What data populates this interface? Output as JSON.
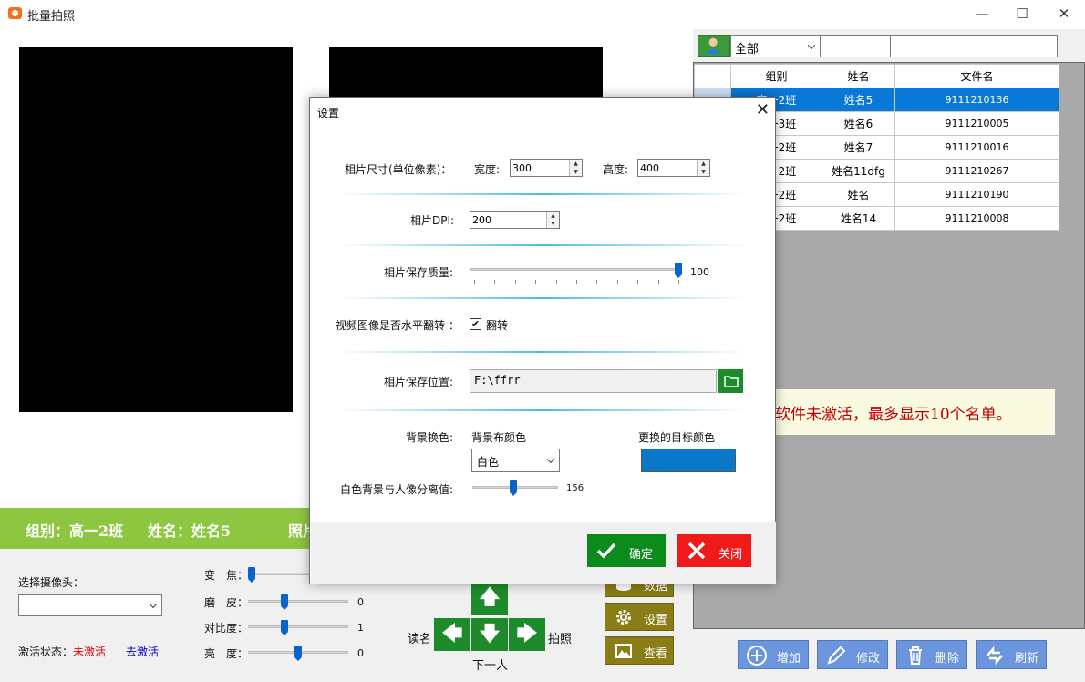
{
  "window": {
    "title": "批量拍照",
    "minimize_icon": "minimize-icon",
    "maximize_icon": "maximize-icon",
    "close_icon": "close-icon"
  },
  "info_bar": {
    "group_text": "组别：高一2班",
    "name_text": "姓名：姓名5",
    "photo_text": "照片"
  },
  "bottom": {
    "camera_label": "选择摄像头：",
    "camera_value": "",
    "activation_label": "激活状态：",
    "activation_status": "未激活",
    "activate_link": "去激活",
    "sliders": [
      {
        "label": "变　焦：",
        "value": "",
        "level": 0.0
      },
      {
        "label": "磨　皮：",
        "value": "0",
        "level": 0.35
      },
      {
        "label": "对比度：",
        "value": "1",
        "level": 0.35
      },
      {
        "label": "亮　度：",
        "value": "0",
        "level": 0.5
      }
    ],
    "read_name_label": "读名",
    "take_photo_label": "拍照",
    "next_person_label": "下一人",
    "side_buttons": [
      {
        "label": "数据",
        "icon": "database-icon"
      },
      {
        "label": "设置",
        "icon": "gear-icon"
      },
      {
        "label": "查看",
        "icon": "image-icon"
      }
    ]
  },
  "right_panel": {
    "filter_value": "全部",
    "filter_input1": "",
    "filter_input2": "",
    "columns": [
      "组别",
      "姓名",
      "文件名"
    ],
    "rows": [
      {
        "group": "高一2班",
        "name": "姓名5",
        "file": "9111210136",
        "selected": true
      },
      {
        "group": "高一3班",
        "name": "姓名6",
        "file": "9111210005",
        "selected": false
      },
      {
        "group": "高一2班",
        "name": "姓名7",
        "file": "9111210016",
        "selected": false
      },
      {
        "group": "高一2班",
        "name": "姓名11dfg",
        "file": "9111210267",
        "selected": false
      },
      {
        "group": "高一2班",
        "name": "姓名",
        "file": "9111210190",
        "selected": false
      },
      {
        "group": "高一2班",
        "name": "姓名14",
        "file": "9111210008",
        "selected": false
      }
    ],
    "notice": "因软件未激活，最多显示10个名单。",
    "actions": [
      {
        "label": "增加",
        "icon": "plus-circle-icon"
      },
      {
        "label": "修改",
        "icon": "pencil-icon"
      },
      {
        "label": "删除",
        "icon": "trash-icon"
      },
      {
        "label": "刷新",
        "icon": "refresh-icon"
      }
    ]
  },
  "dialog": {
    "title": "设置",
    "photo_size_label": "相片尺寸(单位像素)：",
    "width_label": "宽度:",
    "width_value": "300",
    "height_label": "高度:",
    "height_value": "400",
    "dpi_label": "相片DPI:",
    "dpi_value": "200",
    "quality_label": "相片保存质量:",
    "quality_value": "100",
    "quality_level": 1.0,
    "flip_label": "视频图像是否水平翻转 ：",
    "flip_checkbox_label": "翻转",
    "flip_checked": true,
    "save_path_label": "相片保存位置:",
    "save_path_value": "F:\\ffrr",
    "bg_change_label": "背景换色:",
    "bg_cloth_color_label": "背景布颜色",
    "bg_cloth_color_value": "白色",
    "target_color_label": "更换的目标颜色",
    "target_color": "#0a78c8",
    "separation_label": "白色背景与人像分离值:",
    "separation_value": "156",
    "separation_level": 0.5,
    "ok_label": "确定",
    "close_label": "关闭"
  },
  "colors": {
    "accent_green": "#8dc641",
    "selection_blue": "#0a78d7",
    "button_blue": "#6b96dd",
    "button_olive": "#8a7d18"
  }
}
